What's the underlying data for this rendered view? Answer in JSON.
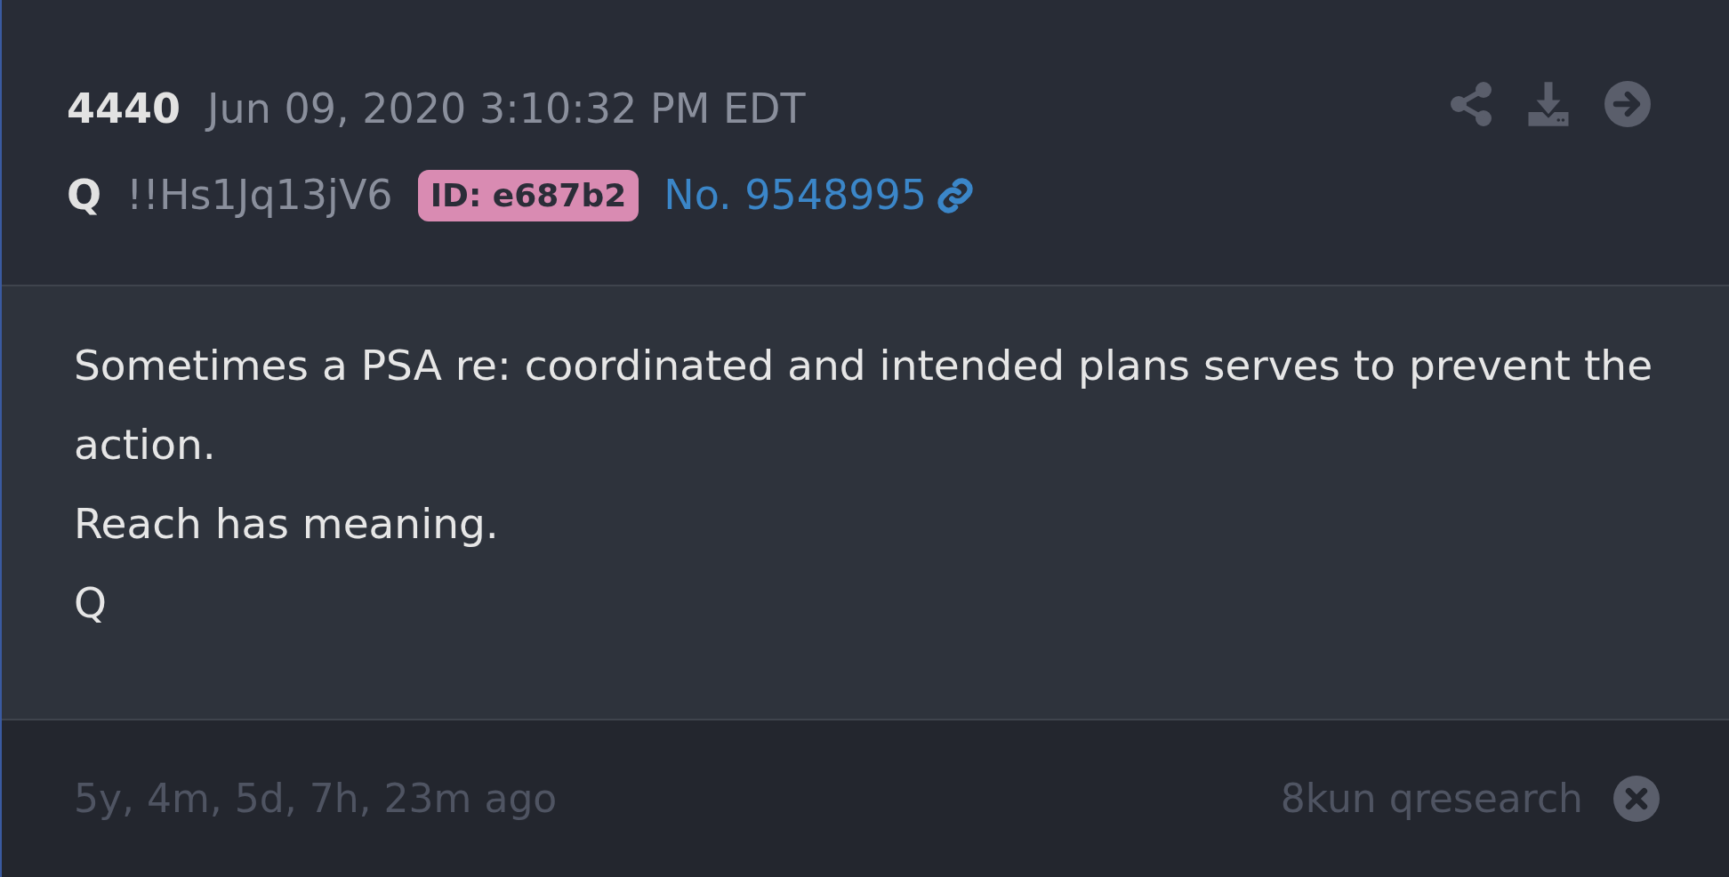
{
  "header": {
    "post_number": "4440",
    "timestamp": "Jun 09, 2020 3:10:32 PM EDT",
    "author": "Q",
    "tripcode": "!!Hs1Jq13jV6",
    "id_badge": "ID: e687b2",
    "post_link": "No. 9548995"
  },
  "body": {
    "lines": [
      "Sometimes a PSA re: coordinated and intended plans serves to prevent the action.",
      "Reach has meaning.",
      "Q"
    ]
  },
  "footer": {
    "time_ago": "5y, 4m, 5d, 7h, 23m ago",
    "source": "8kun qresearch"
  }
}
